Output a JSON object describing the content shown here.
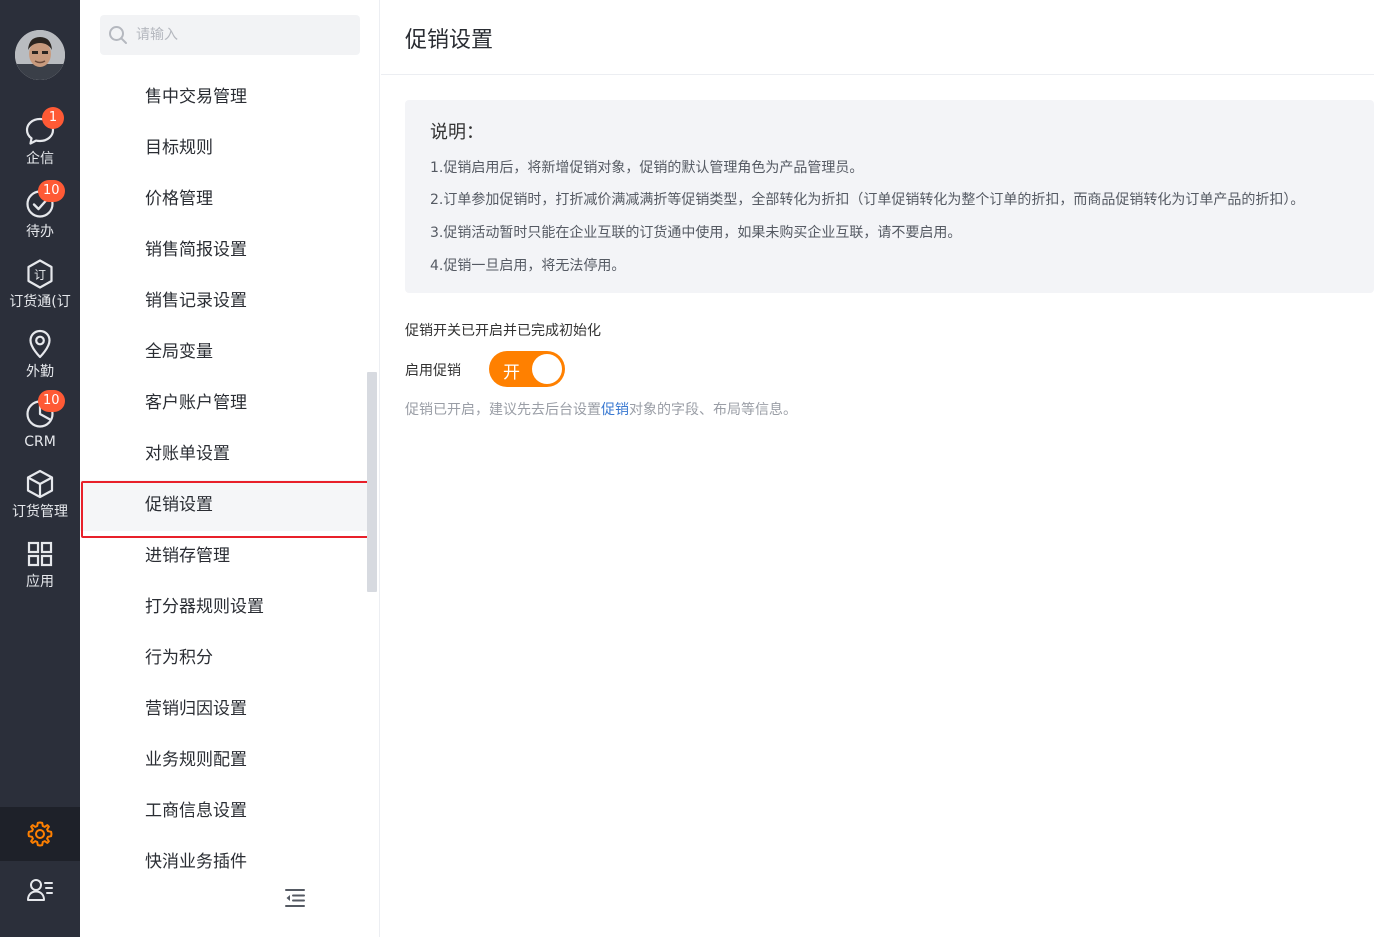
{
  "sidebar": {
    "items": [
      {
        "label": "企信",
        "badge": "1",
        "icon": "chat-bubble-icon"
      },
      {
        "label": "待办",
        "badge": "10",
        "icon": "check-circle-icon"
      },
      {
        "label": "订货通(订",
        "badge": "",
        "icon": "order-hexagon-icon"
      },
      {
        "label": "外勤",
        "badge": "",
        "icon": "location-pin-icon"
      },
      {
        "label": "CRM",
        "badge": "10",
        "icon": "pie-chart-icon"
      },
      {
        "label": "订货管理",
        "badge": "",
        "icon": "cube-icon"
      },
      {
        "label": "应用",
        "badge": "",
        "icon": "grid-apps-icon"
      }
    ],
    "settings_icon": "gear-icon",
    "user_icon": "user-list-icon",
    "accent_color": "#ff8000",
    "badge_color": "#ff5a35"
  },
  "menu": {
    "search_placeholder": "请输入",
    "items": [
      "售中交易管理",
      "目标规则",
      "价格管理",
      "销售简报设置",
      "销售记录设置",
      "全局变量",
      "客户账户管理",
      "对账单设置",
      "促销设置",
      "进销存管理",
      "打分器规则设置",
      "行为积分",
      "营销归因设置",
      "业务规则配置",
      "工商信息设置",
      "快消业务插件"
    ],
    "active_item": "促销设置"
  },
  "main": {
    "title": "促销设置",
    "notice": {
      "title": "说明：",
      "lines": [
        "1.促销启用后，将新增促销对象，促销的默认管理角色为产品管理员。",
        "2.订单参加促销时，打折减价满减满折等促销类型，全部转化为折扣（订单促销转化为整个订单的折扣，而商品促销转化为订单产品的折扣）。",
        "3.促销活动暂时只能在企业互联的订货通中使用，如果未购买企业互联，请不要启用。",
        "4.促销一旦启用，将无法停用。"
      ]
    },
    "status_text": "促销开关已开启并已完成初始化",
    "toggle": {
      "label": "启用促销",
      "state_text": "开",
      "on": true
    },
    "hint": {
      "before": "促销已开启，建议先去后台设置",
      "link": "促销",
      "after": "对象的字段、布局等信息。"
    }
  }
}
